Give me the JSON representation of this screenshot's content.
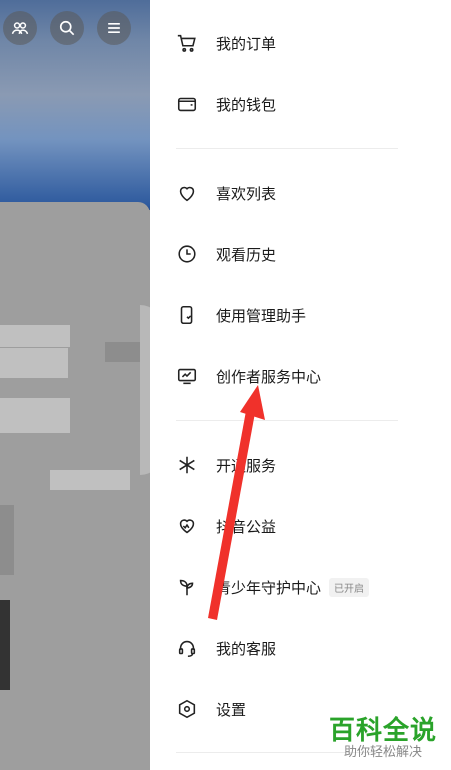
{
  "menu": {
    "section1": [
      {
        "label": "我的订单",
        "icon": "cart-icon"
      },
      {
        "label": "我的钱包",
        "icon": "wallet-icon"
      }
    ],
    "section2": [
      {
        "label": "喜欢列表",
        "icon": "heart-icon"
      },
      {
        "label": "观看历史",
        "icon": "clock-icon"
      },
      {
        "label": "使用管理助手",
        "icon": "phone-check-icon"
      },
      {
        "label": "创作者服务中心",
        "icon": "chart-monitor-icon"
      }
    ],
    "section3": [
      {
        "label": "开通服务",
        "icon": "sparkle-icon"
      },
      {
        "label": "抖音公益",
        "icon": "charity-heart-icon"
      },
      {
        "label": "青少年守护中心",
        "icon": "sprout-icon",
        "badge": "已开启"
      },
      {
        "label": "我的客服",
        "icon": "headset-icon"
      },
      {
        "label": "设置",
        "icon": "settings-hex-icon"
      }
    ]
  },
  "watermark": {
    "title": "百科全说",
    "subtitle": "助你轻松解决"
  },
  "colors": {
    "arrow": "#f0312b",
    "watermark_green": "#2aa32a"
  }
}
